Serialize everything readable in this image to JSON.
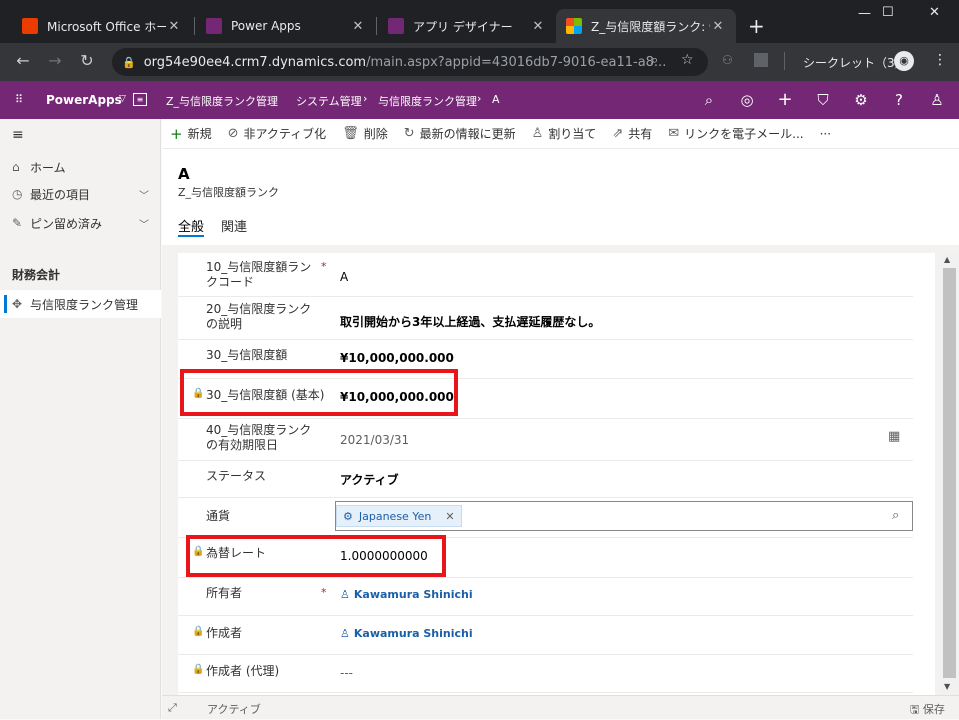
{
  "browser": {
    "tabs": [
      {
        "title": "Microsoft Office ホーム",
        "favicon_color": "#eb3c00"
      },
      {
        "title": "Power Apps",
        "favicon_color": "#742774"
      },
      {
        "title": "アプリ デザイナー",
        "favicon_color": "#742774"
      },
      {
        "title": "Z_与信限度額ランク: 情",
        "favicon_color": "#f25022"
      }
    ],
    "new_tab": "+",
    "url_host": "org54e90ee4.crm7.dynamics.com",
    "url_path": "/main.aspx?appid=43016db7-9016-ea11-a8...",
    "incognito_label": "シークレット（3）",
    "window_controls": [
      "—",
      "☐",
      "✕"
    ]
  },
  "app": {
    "name": "PowerApps",
    "module": "Z_与信限度ランク管理",
    "breadcrumb": [
      "システム管理",
      "与信限度ランク管理",
      "A"
    ],
    "accent": "#742774"
  },
  "sidebar": {
    "home": "ホーム",
    "recent": "最近の項目",
    "pinned": "ピン留め済み",
    "group": "財務会計",
    "entity": "与信限度ランク管理"
  },
  "commands": [
    "新規",
    "非アクティブ化",
    "削除",
    "最新の情報に更新",
    "割り当て",
    "共有",
    "リンクを電子メール...",
    "···"
  ],
  "record": {
    "title": "A",
    "entity": "Z_与信限度額ランク",
    "tabs": [
      "全般",
      "関連"
    ]
  },
  "fields": {
    "code_label": "10_与信限度額ランクコード",
    "code_value": "A",
    "desc_label": "20_与信限度ランクの説明",
    "desc_value": "取引開始から3年以上経過、支払遅延履歴なし。",
    "limit_label": "30_与信限度額",
    "limit_value": "¥10,000,000.000",
    "limit_base_label": "30_与信限度額 (基本)",
    "limit_base_value": "¥10,000,000.000",
    "expiry_label": "40_与信限度ランクの有効期限日",
    "expiry_value": "2021/03/31",
    "status_label": "ステータス",
    "status_value": "アクティブ",
    "currency_label": "通貨",
    "currency_value": "Japanese Yen",
    "rate_label": "為替レート",
    "rate_value": "1.0000000000",
    "owner_label": "所有者",
    "owner_value": "Kawamura Shinichi",
    "creator_label": "作成者",
    "creator_value": "Kawamura Shinichi",
    "delegate_label": "作成者 (代理)",
    "delegate_value": "---"
  },
  "status_bar": {
    "state": "アクティブ",
    "save": "保存"
  },
  "colors": {
    "highlight": "#e8151a",
    "link": "#1b5fa8"
  }
}
